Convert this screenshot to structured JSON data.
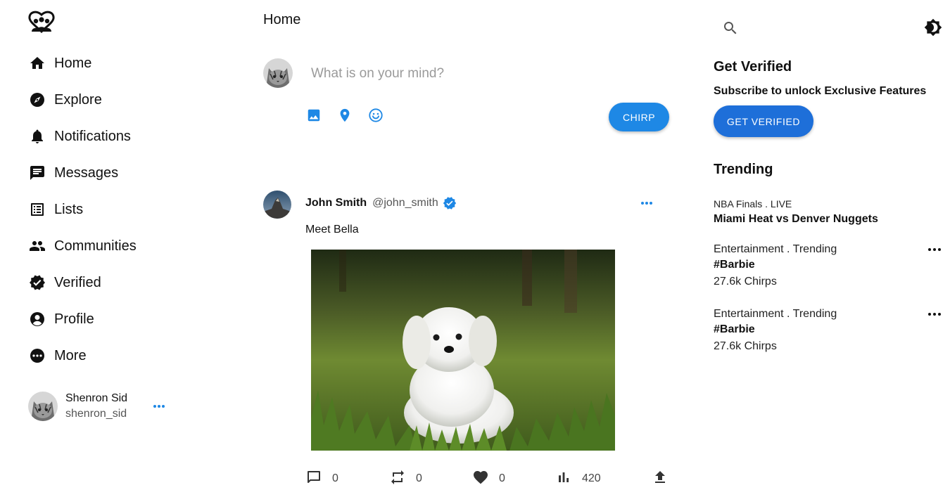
{
  "app": {
    "logo_icon": "community-logo-icon"
  },
  "sidebar": {
    "items": [
      {
        "label": "Home",
        "icon": "home-icon"
      },
      {
        "label": "Explore",
        "icon": "compass-icon"
      },
      {
        "label": "Notifications",
        "icon": "bell-icon"
      },
      {
        "label": "Messages",
        "icon": "message-icon"
      },
      {
        "label": "Lists",
        "icon": "list-icon"
      },
      {
        "label": "Communities",
        "icon": "people-icon"
      },
      {
        "label": "Verified",
        "icon": "verified-icon"
      },
      {
        "label": "Profile",
        "icon": "profile-icon"
      },
      {
        "label": "More",
        "icon": "more-circle-icon"
      }
    ],
    "account": {
      "name": "Shenron Sid",
      "handle": "shenron_sid"
    }
  },
  "main": {
    "title": "Home",
    "composer": {
      "placeholder": "What is on your mind?",
      "button_label": "CHIRP"
    },
    "post": {
      "name": "John Smith",
      "handle": "@john_smith",
      "text": "Meet Bella",
      "actions": {
        "replies": "0",
        "rechirps": "0",
        "likes": "0",
        "views": "420"
      }
    }
  },
  "right": {
    "get_verified": {
      "title": "Get Verified",
      "subtitle": "Subscribe to unlock Exclusive Features",
      "button_label": "GET VERIFIED"
    },
    "trending": {
      "title": "Trending",
      "items": [
        {
          "category": "NBA Finals . LIVE",
          "topic": "Miami Heat vs Denver Nuggets",
          "count": ""
        },
        {
          "category": "Entertainment . Trending",
          "topic": "#Barbie",
          "count": "27.6k Chirps"
        },
        {
          "category": "Entertainment . Trending",
          "topic": "#Barbie",
          "count": "27.6k Chirps"
        }
      ]
    }
  },
  "colors": {
    "accent": "#1e88e5",
    "button_dark": "#1e6fd9"
  }
}
